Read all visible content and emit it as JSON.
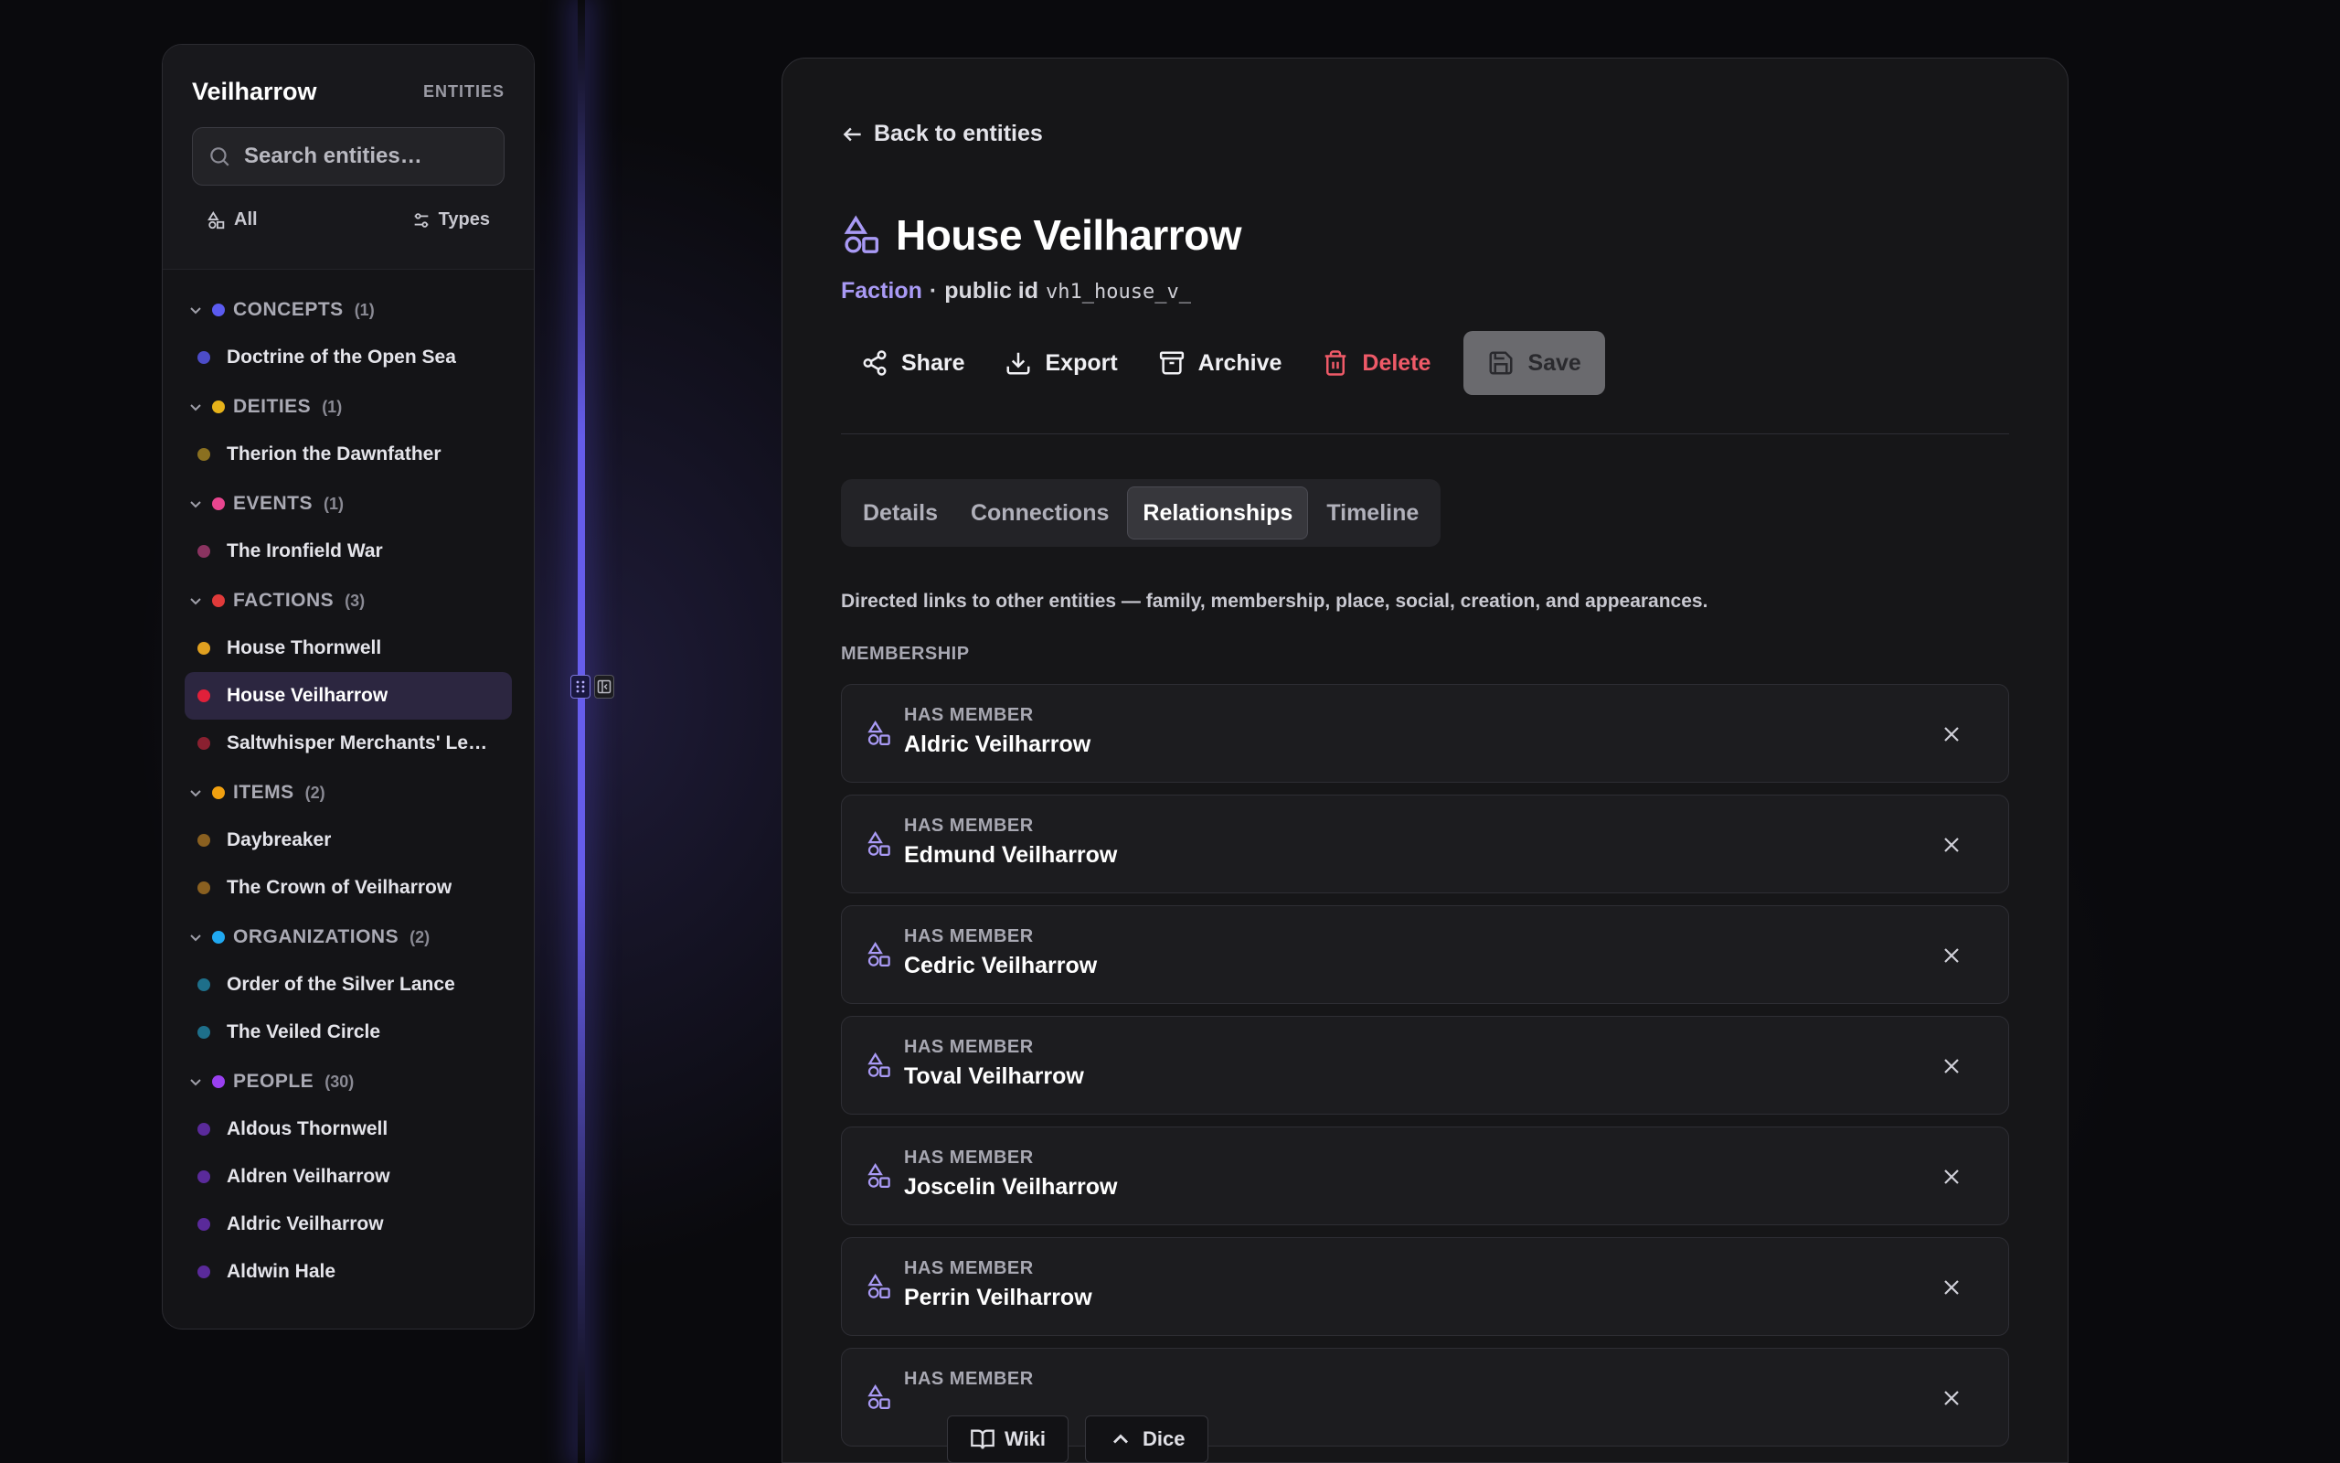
{
  "sidebar": {
    "title": "Veilharrow",
    "subtitle": "ENTITIES",
    "search_placeholder": "Search entities…",
    "filter_all": "All",
    "filter_types": "Types",
    "groups": [
      {
        "name": "CONCEPTS",
        "count": "(1)",
        "color": "#5b5bf0",
        "items": [
          {
            "name": "Doctrine of the Open Sea",
            "color": "#4c4cc8"
          }
        ]
      },
      {
        "name": "DEITIES",
        "count": "(1)",
        "color": "#e6b21a",
        "items": [
          {
            "name": "Therion the Dawnfather",
            "color": "#8a7020"
          }
        ]
      },
      {
        "name": "EVENTS",
        "count": "(1)",
        "color": "#e8458f",
        "items": [
          {
            "name": "The Ironfield War",
            "color": "#8a3360"
          }
        ]
      },
      {
        "name": "FACTIONS",
        "count": "(3)",
        "color": "#e03a3a",
        "items": [
          {
            "name": "House Thornwell",
            "color": "#e0a020"
          },
          {
            "name": "House Veilharrow",
            "color": "#e0203a",
            "active": true
          },
          {
            "name": "Saltwhisper Merchants' League",
            "color": "#8a2030"
          }
        ]
      },
      {
        "name": "ITEMS",
        "count": "(2)",
        "color": "#f0a010",
        "items": [
          {
            "name": "Daybreaker",
            "color": "#8a6020"
          },
          {
            "name": "The Crown of Veilharrow",
            "color": "#8a6020"
          }
        ]
      },
      {
        "name": "ORGANIZATIONS",
        "count": "(2)",
        "color": "#20a8f0",
        "items": [
          {
            "name": "Order of the Silver Lance",
            "color": "#1e6f8a"
          },
          {
            "name": "The Veiled Circle",
            "color": "#1e6f8a"
          }
        ]
      },
      {
        "name": "PEOPLE",
        "count": "(30)",
        "color": "#9a40f0",
        "items": [
          {
            "name": "Aldous Thornwell",
            "color": "#5a2a9a"
          },
          {
            "name": "Aldren Veilharrow",
            "color": "#5a2a9a"
          },
          {
            "name": "Aldric Veilharrow",
            "color": "#5a2a9a"
          },
          {
            "name": "Aldwin Hale",
            "color": "#5a2a9a"
          }
        ]
      }
    ]
  },
  "main": {
    "back_label": "Back to entities",
    "title": "House Veilharrow",
    "type": "Faction",
    "separator": "·",
    "public_id_label": "public id",
    "public_id": "vh1_house_v_",
    "actions": {
      "share": "Share",
      "export": "Export",
      "archive": "Archive",
      "delete": "Delete",
      "save": "Save"
    },
    "tabs": [
      "Details",
      "Connections",
      "Relationships",
      "Timeline"
    ],
    "active_tab": "Relationships",
    "description": "Directed links to other entities — family, membership, place, social, creation, and appearances.",
    "section": "MEMBERSHIP",
    "relationships": [
      {
        "label": "HAS MEMBER",
        "name": "Aldric Veilharrow"
      },
      {
        "label": "HAS MEMBER",
        "name": "Edmund Veilharrow"
      },
      {
        "label": "HAS MEMBER",
        "name": "Cedric Veilharrow"
      },
      {
        "label": "HAS MEMBER",
        "name": "Toval Veilharrow"
      },
      {
        "label": "HAS MEMBER",
        "name": "Joscelin Veilharrow"
      },
      {
        "label": "HAS MEMBER",
        "name": "Perrin Veilharrow"
      },
      {
        "label": "HAS MEMBER",
        "name": ""
      }
    ]
  },
  "bottom": {
    "wiki": "Wiki",
    "dice": "Dice"
  },
  "colors": {
    "accent": "#a99af5",
    "danger": "#ef5a68",
    "divider_glow": "#6e64ff"
  }
}
